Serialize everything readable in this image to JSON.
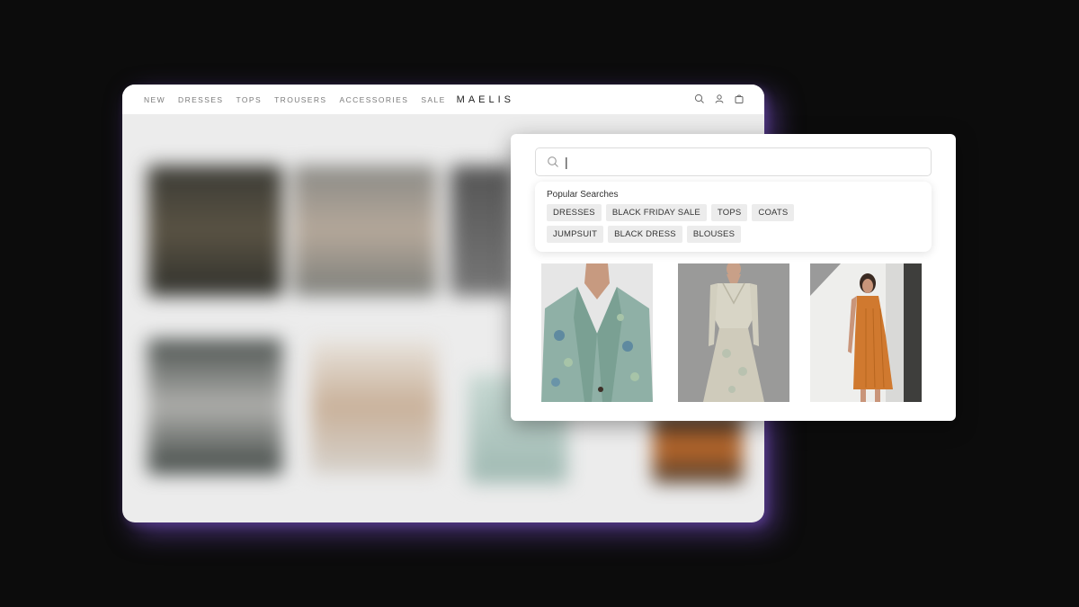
{
  "store": {
    "nav_items": [
      "NEW",
      "DRESSES",
      "TOPS",
      "TROUSERS",
      "ACCESSORIES",
      "SALE"
    ],
    "brand": "MAELIS",
    "icons": [
      "search-icon",
      "user-icon",
      "bag-icon"
    ]
  },
  "search": {
    "value": "|",
    "popular_title": "Popular Searches",
    "tags_row1": [
      "DRESSES",
      "BLACK FRIDAY SALE",
      "TOPS",
      "COATS"
    ],
    "tags_row2": [
      "JUMPSUIT",
      "BLACK DRESS",
      "BLOUSES"
    ]
  },
  "products": [
    {
      "name": "floral-blazer"
    },
    {
      "name": "printed-wrap-dress"
    },
    {
      "name": "orange-knit-dress"
    }
  ],
  "colors": {
    "background": "#0c0c0c",
    "glow": "#7850c8",
    "tag_bg": "#ececec"
  }
}
